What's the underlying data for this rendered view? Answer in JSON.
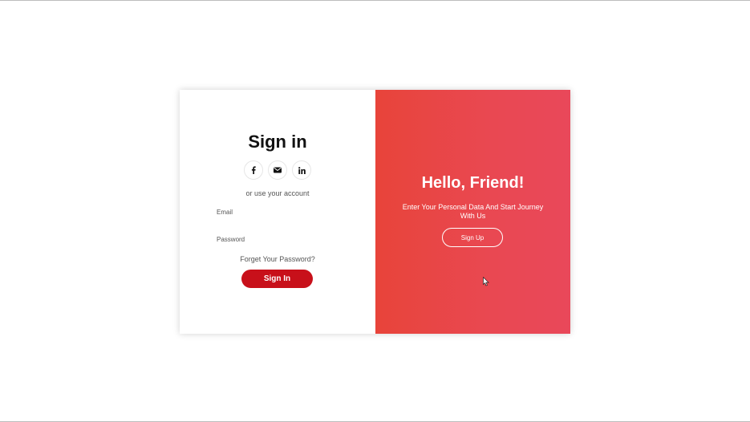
{
  "signin": {
    "title": "Sign in",
    "social_icons": [
      "facebook-icon",
      "envelope-icon",
      "linkedin-icon"
    ],
    "alt_text": "or use your account",
    "email_placeholder": "Email",
    "password_placeholder": "Password",
    "forgot_label": "Forget Your Password?",
    "button_label": "Sign In"
  },
  "overlay": {
    "title": "Hello, Friend!",
    "subtitle": "Enter Your Personal Data And Start Journey With Us",
    "button_label": "Sign Up"
  },
  "colors": {
    "accent": "#c8101a",
    "panel_gradient_start": "#e8443a",
    "panel_gradient_end": "#e9485a"
  }
}
